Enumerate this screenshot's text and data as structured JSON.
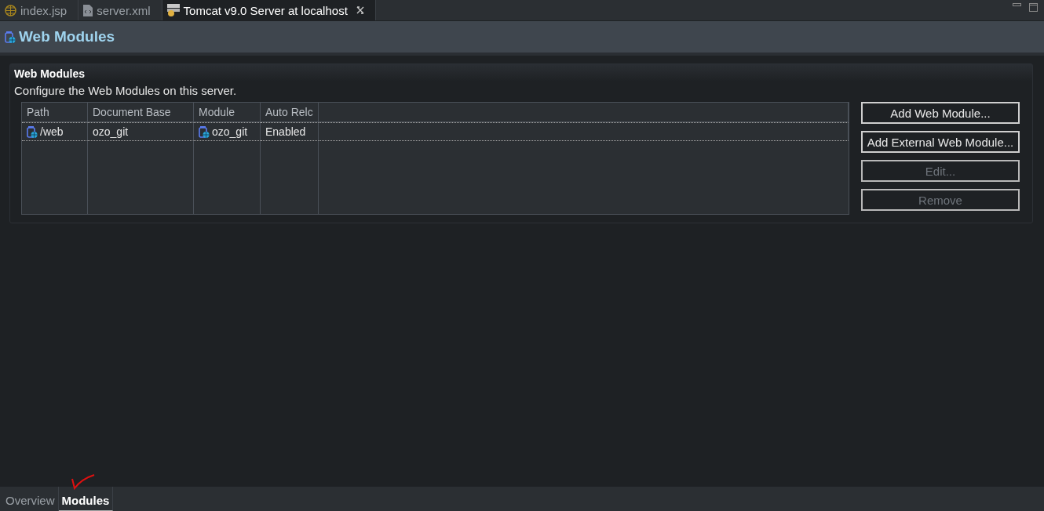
{
  "editor_tabs": [
    {
      "label": "index.jsp",
      "kind": "jsp",
      "selected": false,
      "closable": false
    },
    {
      "label": "server.xml",
      "kind": "xml",
      "selected": false,
      "closable": false
    },
    {
      "label": "Tomcat v9.0 Server at localhost",
      "kind": "server",
      "selected": true,
      "closable": true
    }
  ],
  "page_title": "Web Modules",
  "section": {
    "title": "Web Modules",
    "description": "Configure the Web Modules on this server."
  },
  "table": {
    "columns": [
      "Path",
      "Document Base",
      "Module",
      "Auto Relc"
    ],
    "rows": [
      {
        "path": "/web",
        "document_base": "ozo_git",
        "module": "ozo_git",
        "auto_reload": "Enabled",
        "selected": true
      }
    ]
  },
  "buttons": [
    {
      "label": "Add Web Module...",
      "disabled": false
    },
    {
      "label": "Add External Web Module...",
      "disabled": false
    },
    {
      "label": "Edit...",
      "disabled": true
    },
    {
      "label": "Remove",
      "disabled": true
    }
  ],
  "page_tabs": [
    {
      "label": "Overview",
      "selected": false
    },
    {
      "label": "Modules",
      "selected": true
    }
  ]
}
